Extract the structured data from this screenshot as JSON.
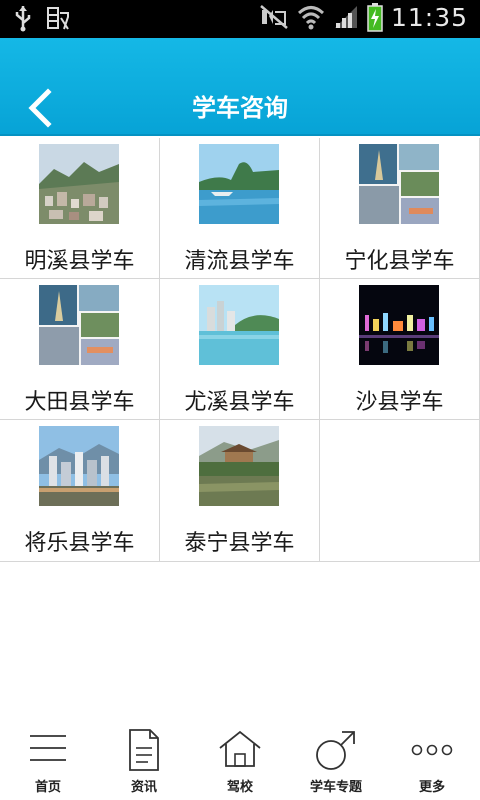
{
  "status_bar": {
    "time": "11:35",
    "icons": [
      "usb-icon",
      "debug-icon",
      "mute-icon",
      "wifi-icon",
      "signal-icon",
      "battery-charging-icon"
    ]
  },
  "header": {
    "title": "学车咨询",
    "back_icon": "chevron-left-icon"
  },
  "grid": {
    "items": [
      {
        "label": "明溪县学车",
        "image": "mountain-town-photo"
      },
      {
        "label": "清流县学车",
        "image": "lake-cliff-photo"
      },
      {
        "label": "宁化县学车",
        "image": "city-collage-photo"
      },
      {
        "label": "大田县学车",
        "image": "city-collage-photo"
      },
      {
        "label": "尤溪县学车",
        "image": "riverside-city-photo"
      },
      {
        "label": "沙县学车",
        "image": "night-city-photo"
      },
      {
        "label": "将乐县学车",
        "image": "skyline-photo"
      },
      {
        "label": "泰宁县学车",
        "image": "pavilion-lake-photo"
      }
    ]
  },
  "bottom_nav": {
    "items": [
      {
        "label": "首页",
        "icon": "menu-icon"
      },
      {
        "label": "资讯",
        "icon": "document-icon"
      },
      {
        "label": "驾校",
        "icon": "house-icon"
      },
      {
        "label": "学车专题",
        "icon": "male-symbol-icon"
      },
      {
        "label": "更多",
        "icon": "more-dots-icon"
      }
    ]
  }
}
